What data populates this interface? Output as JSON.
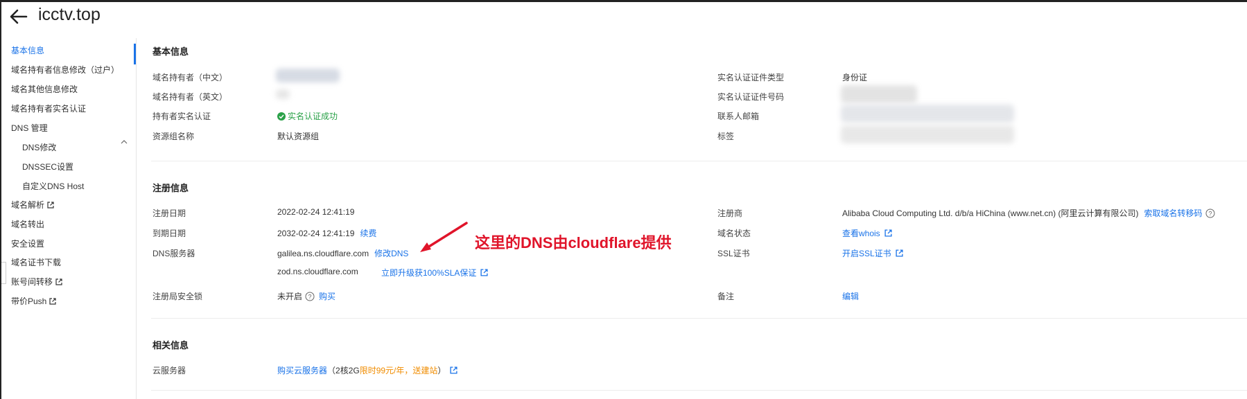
{
  "header": {
    "title": "icctv.top"
  },
  "sidebar": {
    "items": [
      {
        "label": "基本信息"
      },
      {
        "label": "域名持有者信息修改（过户）"
      },
      {
        "label": "域名其他信息修改"
      },
      {
        "label": "域名持有者实名认证"
      },
      {
        "label": "DNS 管理"
      },
      {
        "label": "DNS修改"
      },
      {
        "label": "DNSSEC设置"
      },
      {
        "label": "自定义DNS Host"
      },
      {
        "label": "域名解析"
      },
      {
        "label": "域名转出"
      },
      {
        "label": "安全设置"
      },
      {
        "label": "域名证书下载"
      },
      {
        "label": "账号间转移"
      },
      {
        "label": "带价Push"
      }
    ]
  },
  "basic": {
    "title": "基本信息",
    "owner_cn_label": "域名持有者（中文）",
    "owner_en_label": "域名持有者（英文）",
    "realname_label": "持有者实名认证",
    "realname_status": "实名认证成功",
    "group_label": "资源组名称",
    "group_value": "默认资源组",
    "cert_type_label": "实名认证证件类型",
    "cert_type_value": "身份证",
    "cert_no_label": "实名认证证件号码",
    "email_label": "联系人邮箱",
    "tag_label": "标签"
  },
  "reg": {
    "title": "注册信息",
    "reg_date_label": "注册日期",
    "reg_date": "2022-02-24 12:41:19",
    "exp_date_label": "到期日期",
    "exp_date": "2032-02-24 12:41:19",
    "renew": "续费",
    "dns_label": "DNS服务器",
    "dns1": "galilea.ns.cloudflare.com",
    "modify_dns": "修改DNS",
    "dns2": "zod.ns.cloudflare.com",
    "sla_link": "立即升级获100%SLA保证",
    "lock_label": "注册局安全锁",
    "lock_value": "未开启",
    "buy": "购买",
    "registrar_label": "注册商",
    "registrar_value": "Alibaba Cloud Computing Ltd. d/b/a HiChina (www.net.cn) (阿里云计算有限公司)",
    "transfer_code": "索取域名转移码",
    "status_label": "域名状态",
    "whois": "查看whois",
    "ssl_label": "SSL证书",
    "ssl_link": "开启SSL证书",
    "remark_label": "备注",
    "edit": "编辑"
  },
  "related": {
    "title": "相关信息",
    "server_label": "云服务器",
    "buy_server": "购买云服务器",
    "spec_open": "（2核2G",
    "promo": "限时99元/年，送建站",
    "spec_close": "）"
  },
  "annotation": {
    "text": "这里的DNS由cloudflare提供"
  },
  "colors": {
    "accent": "#1a73e8",
    "success": "#2aa148",
    "promo": "#f08c00",
    "annotation": "#e0142a"
  }
}
